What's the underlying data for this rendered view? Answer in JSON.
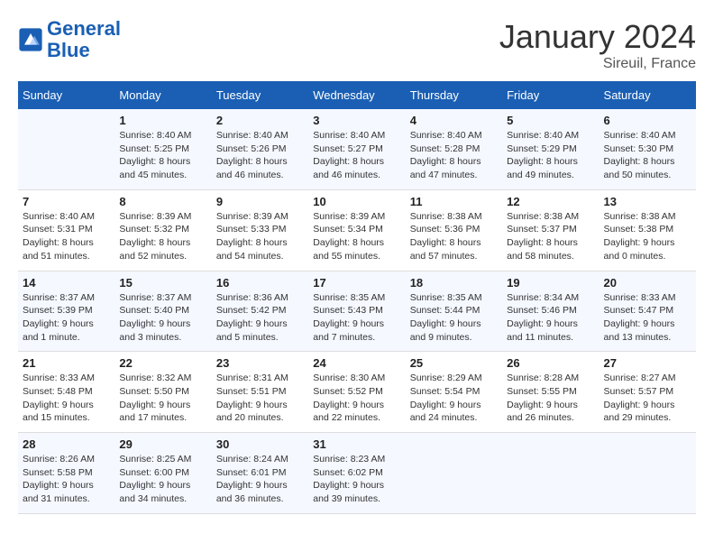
{
  "header": {
    "logo_line1": "General",
    "logo_line2": "Blue",
    "month_year": "January 2024",
    "location": "Sireuil, France"
  },
  "days_of_week": [
    "Sunday",
    "Monday",
    "Tuesday",
    "Wednesday",
    "Thursday",
    "Friday",
    "Saturday"
  ],
  "weeks": [
    [
      {
        "num": "",
        "info": ""
      },
      {
        "num": "1",
        "info": "Sunrise: 8:40 AM\nSunset: 5:25 PM\nDaylight: 8 hours\nand 45 minutes."
      },
      {
        "num": "2",
        "info": "Sunrise: 8:40 AM\nSunset: 5:26 PM\nDaylight: 8 hours\nand 46 minutes."
      },
      {
        "num": "3",
        "info": "Sunrise: 8:40 AM\nSunset: 5:27 PM\nDaylight: 8 hours\nand 46 minutes."
      },
      {
        "num": "4",
        "info": "Sunrise: 8:40 AM\nSunset: 5:28 PM\nDaylight: 8 hours\nand 47 minutes."
      },
      {
        "num": "5",
        "info": "Sunrise: 8:40 AM\nSunset: 5:29 PM\nDaylight: 8 hours\nand 49 minutes."
      },
      {
        "num": "6",
        "info": "Sunrise: 8:40 AM\nSunset: 5:30 PM\nDaylight: 8 hours\nand 50 minutes."
      }
    ],
    [
      {
        "num": "7",
        "info": "Sunrise: 8:40 AM\nSunset: 5:31 PM\nDaylight: 8 hours\nand 51 minutes."
      },
      {
        "num": "8",
        "info": "Sunrise: 8:39 AM\nSunset: 5:32 PM\nDaylight: 8 hours\nand 52 minutes."
      },
      {
        "num": "9",
        "info": "Sunrise: 8:39 AM\nSunset: 5:33 PM\nDaylight: 8 hours\nand 54 minutes."
      },
      {
        "num": "10",
        "info": "Sunrise: 8:39 AM\nSunset: 5:34 PM\nDaylight: 8 hours\nand 55 minutes."
      },
      {
        "num": "11",
        "info": "Sunrise: 8:38 AM\nSunset: 5:36 PM\nDaylight: 8 hours\nand 57 minutes."
      },
      {
        "num": "12",
        "info": "Sunrise: 8:38 AM\nSunset: 5:37 PM\nDaylight: 8 hours\nand 58 minutes."
      },
      {
        "num": "13",
        "info": "Sunrise: 8:38 AM\nSunset: 5:38 PM\nDaylight: 9 hours\nand 0 minutes."
      }
    ],
    [
      {
        "num": "14",
        "info": "Sunrise: 8:37 AM\nSunset: 5:39 PM\nDaylight: 9 hours\nand 1 minute."
      },
      {
        "num": "15",
        "info": "Sunrise: 8:37 AM\nSunset: 5:40 PM\nDaylight: 9 hours\nand 3 minutes."
      },
      {
        "num": "16",
        "info": "Sunrise: 8:36 AM\nSunset: 5:42 PM\nDaylight: 9 hours\nand 5 minutes."
      },
      {
        "num": "17",
        "info": "Sunrise: 8:35 AM\nSunset: 5:43 PM\nDaylight: 9 hours\nand 7 minutes."
      },
      {
        "num": "18",
        "info": "Sunrise: 8:35 AM\nSunset: 5:44 PM\nDaylight: 9 hours\nand 9 minutes."
      },
      {
        "num": "19",
        "info": "Sunrise: 8:34 AM\nSunset: 5:46 PM\nDaylight: 9 hours\nand 11 minutes."
      },
      {
        "num": "20",
        "info": "Sunrise: 8:33 AM\nSunset: 5:47 PM\nDaylight: 9 hours\nand 13 minutes."
      }
    ],
    [
      {
        "num": "21",
        "info": "Sunrise: 8:33 AM\nSunset: 5:48 PM\nDaylight: 9 hours\nand 15 minutes."
      },
      {
        "num": "22",
        "info": "Sunrise: 8:32 AM\nSunset: 5:50 PM\nDaylight: 9 hours\nand 17 minutes."
      },
      {
        "num": "23",
        "info": "Sunrise: 8:31 AM\nSunset: 5:51 PM\nDaylight: 9 hours\nand 20 minutes."
      },
      {
        "num": "24",
        "info": "Sunrise: 8:30 AM\nSunset: 5:52 PM\nDaylight: 9 hours\nand 22 minutes."
      },
      {
        "num": "25",
        "info": "Sunrise: 8:29 AM\nSunset: 5:54 PM\nDaylight: 9 hours\nand 24 minutes."
      },
      {
        "num": "26",
        "info": "Sunrise: 8:28 AM\nSunset: 5:55 PM\nDaylight: 9 hours\nand 26 minutes."
      },
      {
        "num": "27",
        "info": "Sunrise: 8:27 AM\nSunset: 5:57 PM\nDaylight: 9 hours\nand 29 minutes."
      }
    ],
    [
      {
        "num": "28",
        "info": "Sunrise: 8:26 AM\nSunset: 5:58 PM\nDaylight: 9 hours\nand 31 minutes."
      },
      {
        "num": "29",
        "info": "Sunrise: 8:25 AM\nSunset: 6:00 PM\nDaylight: 9 hours\nand 34 minutes."
      },
      {
        "num": "30",
        "info": "Sunrise: 8:24 AM\nSunset: 6:01 PM\nDaylight: 9 hours\nand 36 minutes."
      },
      {
        "num": "31",
        "info": "Sunrise: 8:23 AM\nSunset: 6:02 PM\nDaylight: 9 hours\nand 39 minutes."
      },
      {
        "num": "",
        "info": ""
      },
      {
        "num": "",
        "info": ""
      },
      {
        "num": "",
        "info": ""
      }
    ]
  ]
}
